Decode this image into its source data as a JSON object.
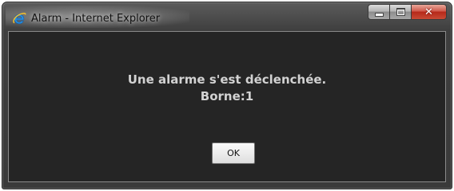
{
  "window": {
    "title": "Alarm - Internet Explorer",
    "app_icon": "internet-explorer-icon",
    "caption_buttons": {
      "minimize_glyph": "minimize-icon",
      "maximize_glyph": "maximize-icon",
      "close_glyph": "✕"
    }
  },
  "dialog": {
    "message_line1": "Une alarme s'est déclenchée.",
    "message_line2": "Borne:1",
    "ok_label": "OK"
  },
  "colors": {
    "chrome_dark": "#3a3a3a",
    "content_background": "#252525",
    "message_text": "#d2d2d2",
    "close_button_red": "#c84a35",
    "ie_icon_blue": "#1e8ad6"
  }
}
